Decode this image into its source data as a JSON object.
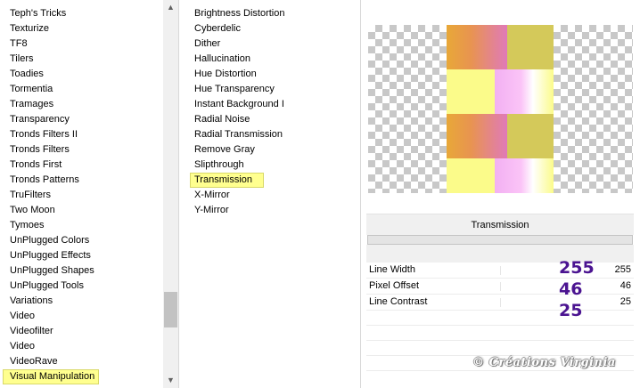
{
  "categories": {
    "items": [
      "Teph's Tricks",
      "Texturize",
      "TF8",
      "Tilers",
      "Toadies",
      "Tormentia",
      "Tramages",
      "Transparency",
      "Tronds Filters II",
      "Tronds Filters",
      "Tronds First",
      "Tronds Patterns",
      "TruFilters",
      "Two Moon",
      "Tymoes",
      "UnPlugged Colors",
      "UnPlugged Effects",
      "UnPlugged Shapes",
      "UnPlugged Tools",
      "Variations",
      "Video",
      "Videofilter",
      "Video",
      "VideoRave",
      "Visual Manipulation"
    ],
    "selected_index": 24,
    "scroll_position": 0.86,
    "scroll_up_icon": "▲",
    "scroll_down_icon": "▼"
  },
  "effects": {
    "items": [
      "Brightness Distortion",
      "Cyberdelic",
      "Dither",
      "Hallucination",
      "Hue Distortion",
      "Hue Transparency",
      "Instant Background I",
      "Radial Noise",
      "Radial Transmission",
      "Remove Gray",
      "Slipthrough",
      "Transmission",
      "X-Mirror",
      "Y-Mirror"
    ],
    "selected_index": 11
  },
  "settings": {
    "title": "Transmission",
    "params": [
      {
        "name": "Line Width",
        "value": "255"
      },
      {
        "name": "Pixel Offset",
        "value": "46"
      },
      {
        "name": "Line Contrast",
        "value": "25"
      }
    ]
  },
  "annotations": [
    "255",
    "46",
    "25"
  ],
  "watermark": "© Créations Virginia",
  "colors": {
    "selection": "#ffff8f",
    "annotation": "#4b1491"
  }
}
